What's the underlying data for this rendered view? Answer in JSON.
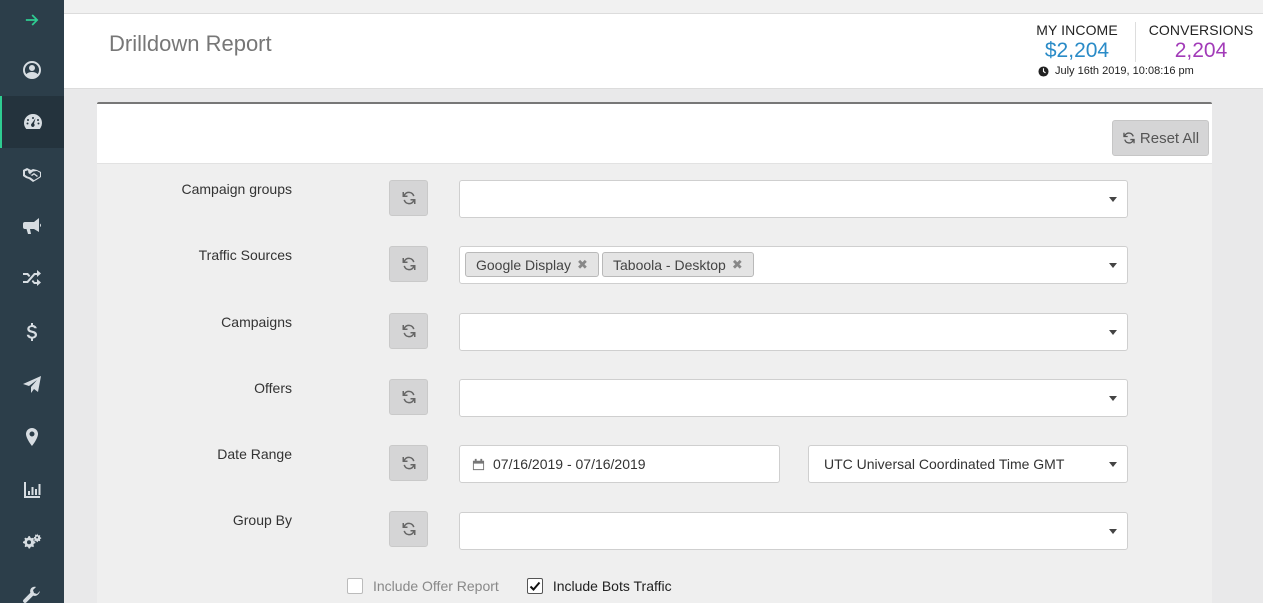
{
  "sidebar": {
    "items": [
      {
        "icon": "arrow-right-icon"
      },
      {
        "icon": "user-icon"
      },
      {
        "icon": "dashboard-icon"
      },
      {
        "icon": "handshake-icon"
      },
      {
        "icon": "megaphone-icon"
      },
      {
        "icon": "shuffle-icon"
      },
      {
        "icon": "dollar-icon"
      },
      {
        "icon": "paper-plane-icon"
      },
      {
        "icon": "map-marker-icon"
      },
      {
        "icon": "bar-chart-icon"
      },
      {
        "icon": "cogs-icon"
      },
      {
        "icon": "wrench-icon"
      }
    ],
    "active_index": 2,
    "accent_color": "#2ecc91"
  },
  "header": {
    "title": "Drilldown Report",
    "income": {
      "label": "MY INCOME",
      "value": "$2,204",
      "color": "#2a8bc7"
    },
    "conversions": {
      "label": "CONVERSIONS",
      "value": "2,204",
      "color": "#a23bb8"
    },
    "timestamp": "July 16th 2019, 10:08:16 pm"
  },
  "panel": {
    "reset_label": "Reset All",
    "filters": {
      "campaign_groups": {
        "label": "Campaign groups"
      },
      "traffic_sources": {
        "label": "Traffic Sources",
        "tags": [
          "Google Display",
          "Taboola - Desktop"
        ]
      },
      "campaigns": {
        "label": "Campaigns"
      },
      "offers": {
        "label": "Offers"
      },
      "date_range": {
        "label": "Date Range",
        "value": "07/16/2019 - 07/16/2019",
        "timezone": "UTC Universal Coordinated Time GMT"
      },
      "group_by": {
        "label": "Group By"
      }
    },
    "checkboxes": {
      "offer_report": {
        "label": "Include Offer Report",
        "checked": false
      },
      "bots_traffic": {
        "label": "Include Bots Traffic",
        "checked": true
      }
    }
  }
}
